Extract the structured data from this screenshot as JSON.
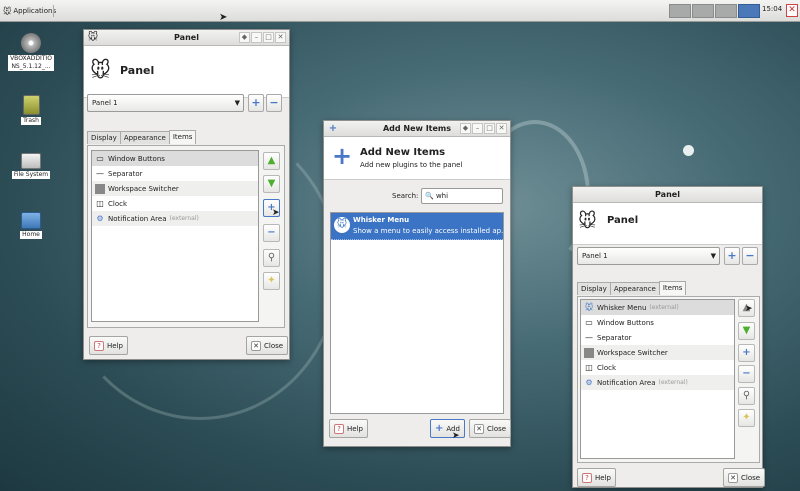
{
  "top_panel": {
    "applications_label": "Applications",
    "clock": "15:04",
    "close_glyph": "✕",
    "workspaces": [
      {
        "active": false
      },
      {
        "active": false
      },
      {
        "active": false
      },
      {
        "active": true
      },
      {
        "active": false
      }
    ]
  },
  "desktop": {
    "icons": [
      {
        "label": "VBOXADDITIONS_5.1.12_...",
        "icon": "disc-icon"
      },
      {
        "label": "Trash",
        "icon": "trash-icon"
      },
      {
        "label": "File System",
        "icon": "drive-icon"
      },
      {
        "label": "Home",
        "icon": "home-folder-icon"
      }
    ]
  },
  "panel_window_left": {
    "title": "Panel",
    "header_title": "Panel",
    "panel_select": "Panel 1",
    "tabs": [
      "Display",
      "Appearance",
      "Items"
    ],
    "active_tab": "Items",
    "items": [
      {
        "label": "Window Buttons",
        "external": ""
      },
      {
        "label": "Separator",
        "external": ""
      },
      {
        "label": "Workspace Switcher",
        "external": ""
      },
      {
        "label": "Clock",
        "external": ""
      },
      {
        "label": "Notification Area",
        "external": "(external)"
      }
    ],
    "help_label": "Help",
    "close_label": "Close"
  },
  "add_items_window": {
    "title": "Add New Items",
    "header_title": "Add New Items",
    "header_subtitle": "Add new plugins to the panel",
    "search_label": "Search:",
    "search_value": "whi",
    "results": [
      {
        "name": "Whisker Menu",
        "description": "Show a menu to easily access installed ap..."
      }
    ],
    "help_label": "Help",
    "add_label": "Add",
    "close_label": "Close"
  },
  "panel_window_right": {
    "title": "Panel",
    "header_title": "Panel",
    "panel_select": "Panel 1",
    "tabs": [
      "Display",
      "Appearance",
      "Items"
    ],
    "active_tab": "Items",
    "items": [
      {
        "label": "Whisker Menu",
        "external": "(external)"
      },
      {
        "label": "Window Buttons",
        "external": ""
      },
      {
        "label": "Separator",
        "external": ""
      },
      {
        "label": "Workspace Switcher",
        "external": ""
      },
      {
        "label": "Clock",
        "external": ""
      },
      {
        "label": "Notification Area",
        "external": "(external)"
      }
    ],
    "help_label": "Help",
    "close_label": "Close"
  },
  "colors": {
    "selection": "#3b74c4",
    "workspace_active": "#4a78b8",
    "accent_blue": "#4a78c8",
    "green_arrow": "#4caf2e"
  }
}
